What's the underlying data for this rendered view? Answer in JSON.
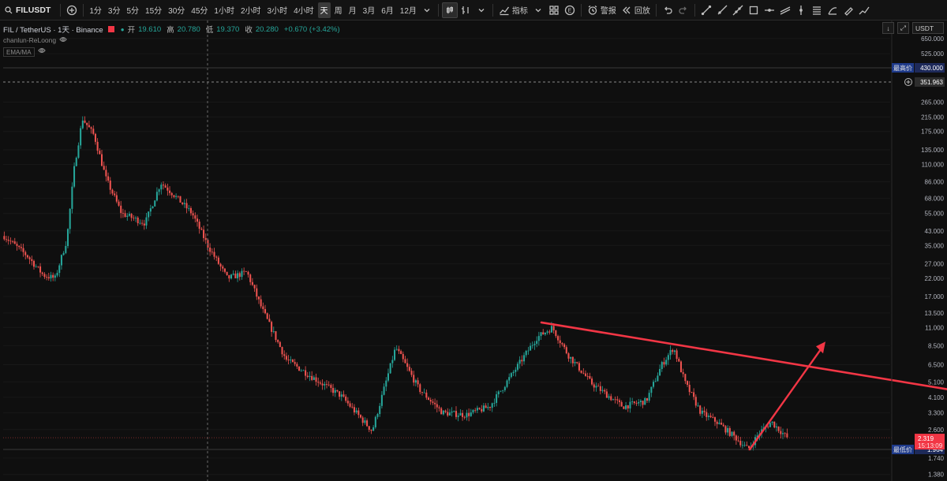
{
  "toolbar": {
    "symbol": "FILUSDT",
    "intervals": [
      "1分",
      "3分",
      "5分",
      "15分",
      "30分",
      "45分",
      "1小时",
      "2小时",
      "3小时",
      "4小时",
      "天",
      "周",
      "月",
      "3月",
      "6月",
      "12月"
    ],
    "active_interval": "天",
    "indicators_label": "指标",
    "alert_label": "警报",
    "replay_label": "回放",
    "template_badge": "E"
  },
  "legend": {
    "title": "FIL / TetherUS · 1天 · Binance",
    "open_label": "开",
    "open_value": "19.610",
    "high_label": "高",
    "high_value": "20.780",
    "low_label": "低",
    "low_value": "19.370",
    "close_label": "收",
    "close_value": "20.280",
    "change": "+0.670 (+3.42%)",
    "script_name": "chanlun-ReLoong",
    "ema_label": "EMA/MA"
  },
  "currency_select": "USDT",
  "colors": {
    "up": "#26a69a",
    "down": "#ef5350",
    "trendline": "#f23645",
    "axis_tag_blue": "#1e3a8a",
    "current_price_tag": "#f23645"
  },
  "chart_data": {
    "type": "candlestick",
    "scale": "log",
    "y_tick_labels": [
      "650.000",
      "525.000",
      "265.000",
      "215.000",
      "175.000",
      "135.000",
      "110.000",
      "86.000",
      "68.000",
      "55.000",
      "43.000",
      "35.000",
      "27.000",
      "22.000",
      "17.000",
      "13.500",
      "11.000",
      "8.500",
      "6.500",
      "5.100",
      "4.100",
      "3.300",
      "2.600",
      "1.740",
      "1.380"
    ],
    "highest_price_label": "最高价",
    "highest_price": 430.0,
    "lowest_price_label": "最低价",
    "lowest_price": 1.964,
    "crosshair_price": "351.963",
    "current_price": "2.319",
    "countdown": "15:13:09",
    "price_path": [
      [
        0,
        40
      ],
      [
        0.03,
        30
      ],
      [
        0.05,
        23
      ],
      [
        0.065,
        22
      ],
      [
        0.08,
        38
      ],
      [
        0.09,
        110
      ],
      [
        0.1,
        210
      ],
      [
        0.115,
        165
      ],
      [
        0.13,
        90
      ],
      [
        0.15,
        55
      ],
      [
        0.18,
        48
      ],
      [
        0.2,
        85
      ],
      [
        0.215,
        73
      ],
      [
        0.24,
        55
      ],
      [
        0.26,
        35
      ],
      [
        0.285,
        22
      ],
      [
        0.31,
        24
      ],
      [
        0.33,
        14
      ],
      [
        0.36,
        7
      ],
      [
        0.4,
        5.2
      ],
      [
        0.43,
        4.2
      ],
      [
        0.47,
        2.55
      ],
      [
        0.5,
        8.3
      ],
      [
        0.53,
        4.6
      ],
      [
        0.56,
        3.3
      ],
      [
        0.59,
        3.2
      ],
      [
        0.62,
        3.6
      ],
      [
        0.65,
        5.8
      ],
      [
        0.68,
        9.5
      ],
      [
        0.7,
        11
      ],
      [
        0.72,
        7.5
      ],
      [
        0.75,
        5
      ],
      [
        0.79,
        3.6
      ],
      [
        0.82,
        3.9
      ],
      [
        0.84,
        6.5
      ],
      [
        0.855,
        8.3
      ],
      [
        0.87,
        5
      ],
      [
        0.89,
        3.3
      ],
      [
        0.91,
        2.9
      ],
      [
        0.935,
        2.3
      ],
      [
        0.95,
        1.964
      ],
      [
        0.965,
        2.5
      ],
      [
        0.98,
        2.9
      ],
      [
        1.0,
        2.32
      ]
    ],
    "trendline": {
      "from": [
        0.0,
        11.8
      ],
      "to": [
        1.0,
        4.6
      ]
    },
    "arrow": {
      "from": [
        0.0,
        1.964
      ],
      "to": [
        1.0,
        9.0
      ]
    }
  }
}
